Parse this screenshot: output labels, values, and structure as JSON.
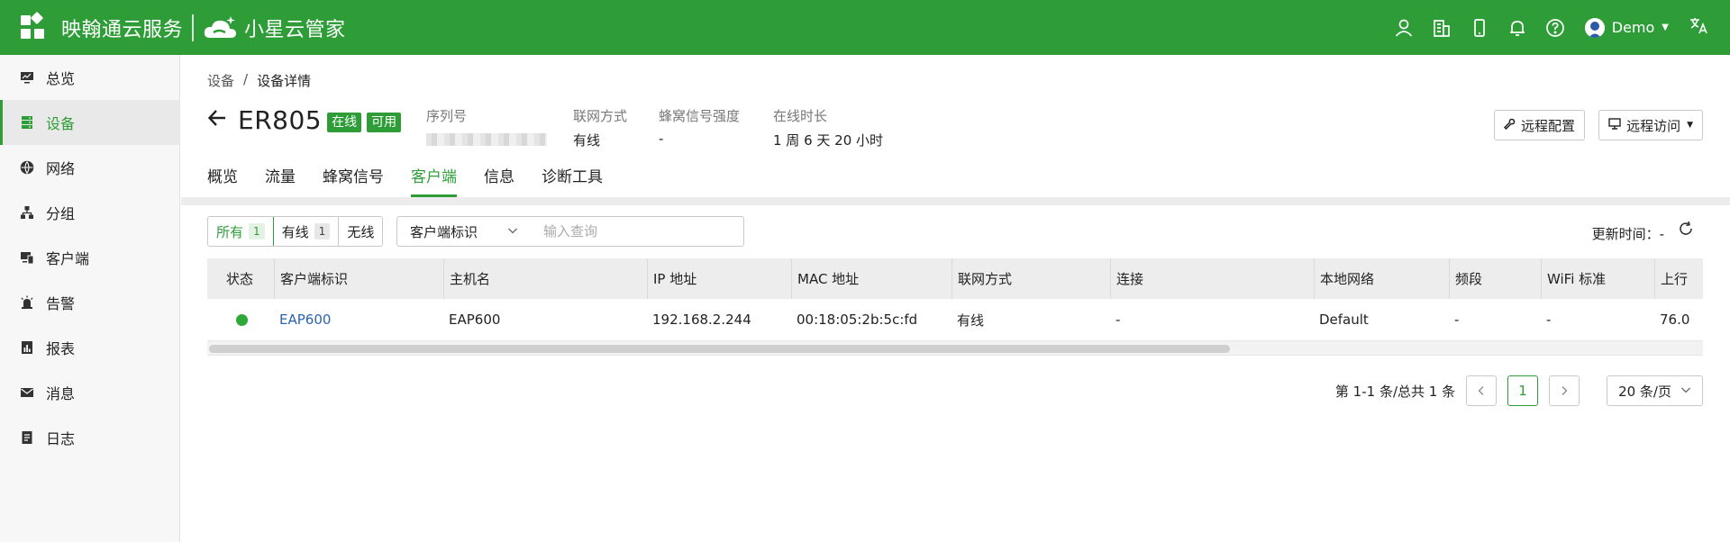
{
  "topbar": {
    "brand": "映翰通云服务",
    "product": "小星云管家",
    "user": "Demo",
    "icons": [
      "user-icon",
      "building-icon",
      "mobile-icon",
      "bell-icon",
      "help-icon",
      "translate-icon"
    ],
    "accent": "#2e9d38"
  },
  "sidebar": {
    "items": [
      {
        "label": "总览",
        "icon": "monitor-icon"
      },
      {
        "label": "设备",
        "icon": "server-icon",
        "active": true
      },
      {
        "label": "网络",
        "icon": "globe-icon"
      },
      {
        "label": "分组",
        "icon": "group-icon"
      },
      {
        "label": "客户端",
        "icon": "clients-icon"
      },
      {
        "label": "告警",
        "icon": "alarm-icon"
      },
      {
        "label": "报表",
        "icon": "report-icon"
      },
      {
        "label": "消息",
        "icon": "mail-icon"
      },
      {
        "label": "日志",
        "icon": "log-icon"
      }
    ]
  },
  "breadcrumb": {
    "root": "设备",
    "sep": "/",
    "current": "设备详情"
  },
  "device": {
    "name": "ER805",
    "badge_online": "在线",
    "badge_available": "可用",
    "serial_label": "序列号",
    "network_label": "联网方式",
    "network_value": "有线",
    "signal_label": "蜂窝信号强度",
    "signal_value": "-",
    "uptime_label": "在线时长",
    "uptime_value": "1 周 6 天 20 小时"
  },
  "actions": {
    "remote_config": "远程配置",
    "remote_access": "远程访问"
  },
  "tabs": [
    "概览",
    "流量",
    "蜂窝信号",
    "客户端",
    "信息",
    "诊断工具"
  ],
  "active_tab": 3,
  "filter": {
    "all_label": "所有",
    "all_count": "1",
    "wired_label": "有线",
    "wired_count": "1",
    "wireless_label": "无线",
    "select_value": "客户端标识",
    "search_placeholder": "输入查询",
    "update_label": "更新时间：-"
  },
  "table": {
    "headers": [
      "状态",
      "客户端标识",
      "主机名",
      "IP 地址",
      "MAC 地址",
      "联网方式",
      "连接",
      "本地网络",
      "频段",
      "WiFi 标准",
      "上行"
    ],
    "rows": [
      {
        "status": "online",
        "client_id": "EAP600",
        "hostname": "EAP600",
        "ip": "192.168.2.244",
        "mac": "00:18:05:2b:5c:fd",
        "network": "有线",
        "connection": "-",
        "local_network": "Default",
        "band": "-",
        "wifi": "-",
        "uplink": "76.0"
      }
    ]
  },
  "pagination": {
    "summary": "第 1-1 条/总共 1 条",
    "prev": "<",
    "page": "1",
    "next": ">",
    "page_size": "20 条/页"
  }
}
